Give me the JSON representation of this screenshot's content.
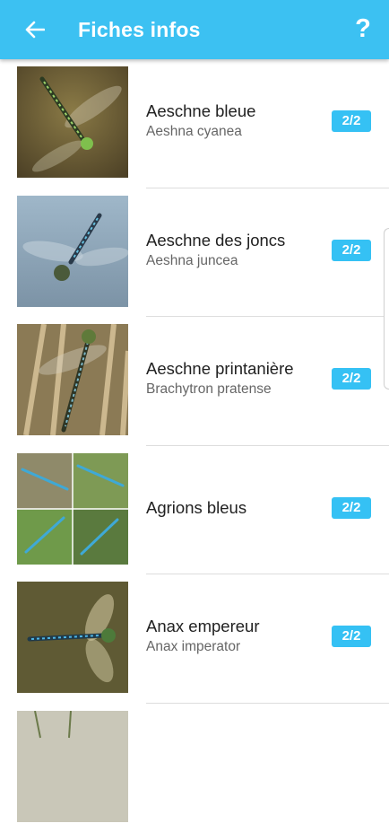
{
  "appbar": {
    "title": "Fiches infos",
    "back_icon": "arrow-left-icon",
    "help_label": "?"
  },
  "colors": {
    "appbar": "#3cc1f2",
    "badge": "#35c1f4",
    "divider": "#dddddd"
  },
  "items": [
    {
      "common": "Aeschne bleue",
      "latin": "Aeshna cyanea",
      "badge": "2/2"
    },
    {
      "common": "Aeschne des joncs",
      "latin": "Aeshna juncea",
      "badge": "2/2"
    },
    {
      "common": "Aeschne printanière",
      "latin": "Brachytron pratense",
      "badge": "2/2"
    },
    {
      "common": "Agrions bleus",
      "latin": "",
      "badge": "2/2"
    },
    {
      "common": "Anax empereur",
      "latin": "Anax imperator",
      "badge": "2/2"
    }
  ]
}
